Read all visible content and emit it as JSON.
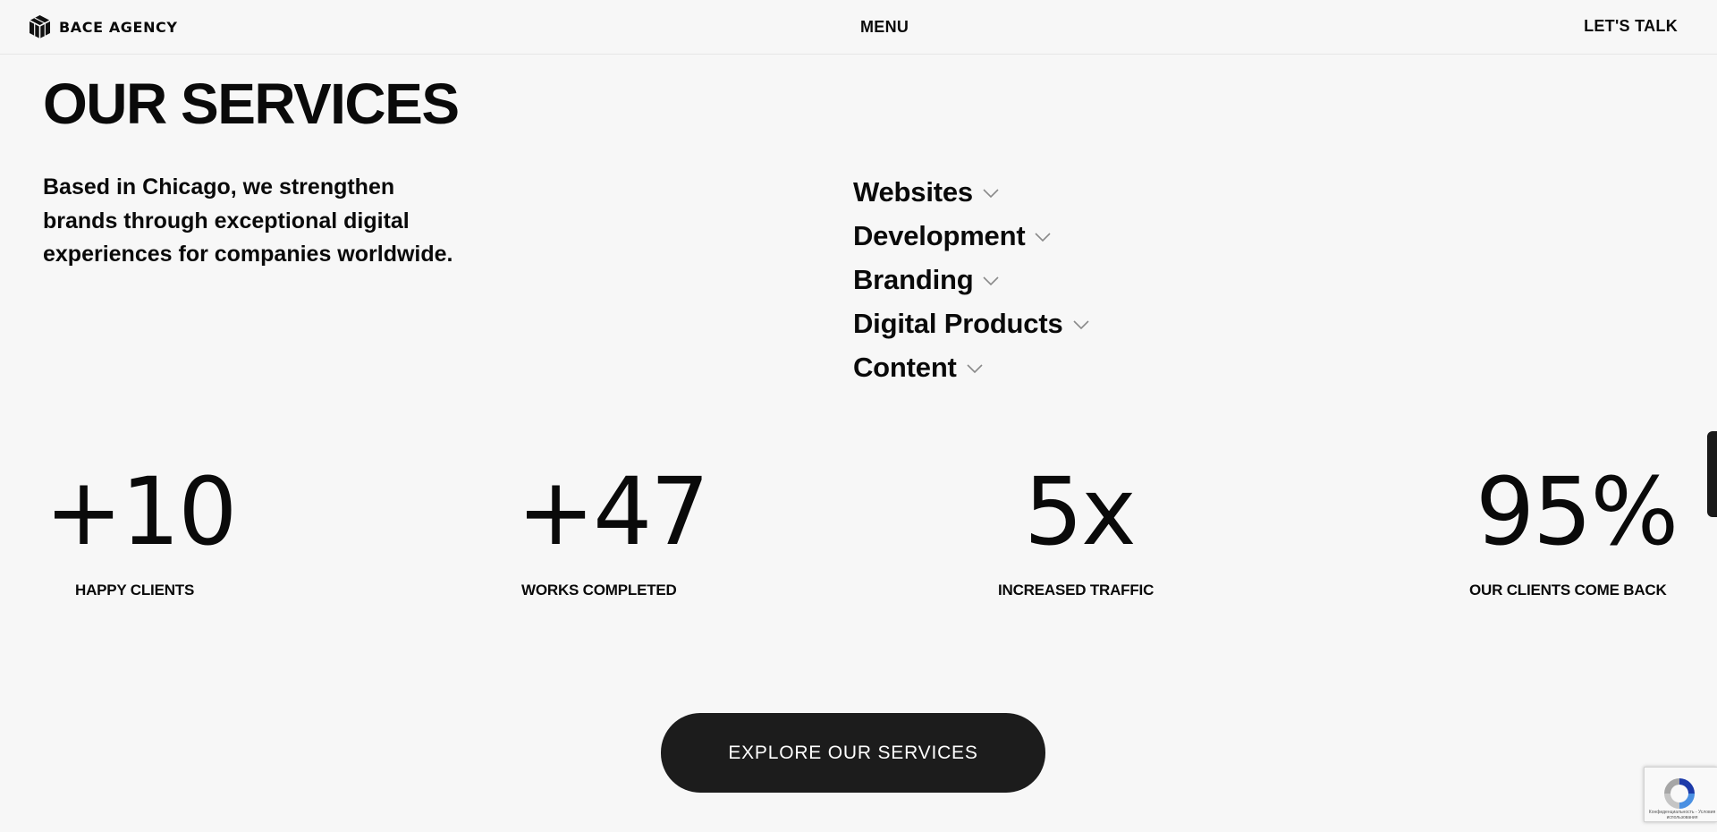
{
  "header": {
    "logo_text": "BACE AGENCY",
    "menu_label": "MENU",
    "cta_label": "LET'S TALK"
  },
  "main": {
    "title": "OUR SERVICES",
    "intro": "Based in Chicago, we strengthen brands through exceptional digital experiences for companies worldwide.",
    "services": [
      {
        "label": "Websites",
        "icon": "chevron-down-icon"
      },
      {
        "label": "Development",
        "icon": "chevron-down-icon"
      },
      {
        "label": "Branding",
        "icon": "chevron-down-icon"
      },
      {
        "label": "Digital Products",
        "icon": "chevron-down-icon"
      },
      {
        "label": "Content",
        "icon": "chevron-down-icon"
      }
    ],
    "stats": [
      {
        "value": "+10",
        "label": "HAPPY CLIENTS"
      },
      {
        "value": "+47",
        "label": "WORKS COMPLETED"
      },
      {
        "value": "5x",
        "label": "INCREASED TRAFFIC"
      },
      {
        "value": "95%",
        "label": "OUR CLIENTS COME BACK"
      }
    ],
    "explore_button": "EXPLORE OUR SERVICES"
  },
  "recaptcha": {
    "text": "Конфиденциальность - Условия использования"
  },
  "colors": {
    "background": "#f7f7f7",
    "text": "#0a0a0a",
    "button_bg": "#1c1c1c",
    "button_text": "#ffffff"
  }
}
